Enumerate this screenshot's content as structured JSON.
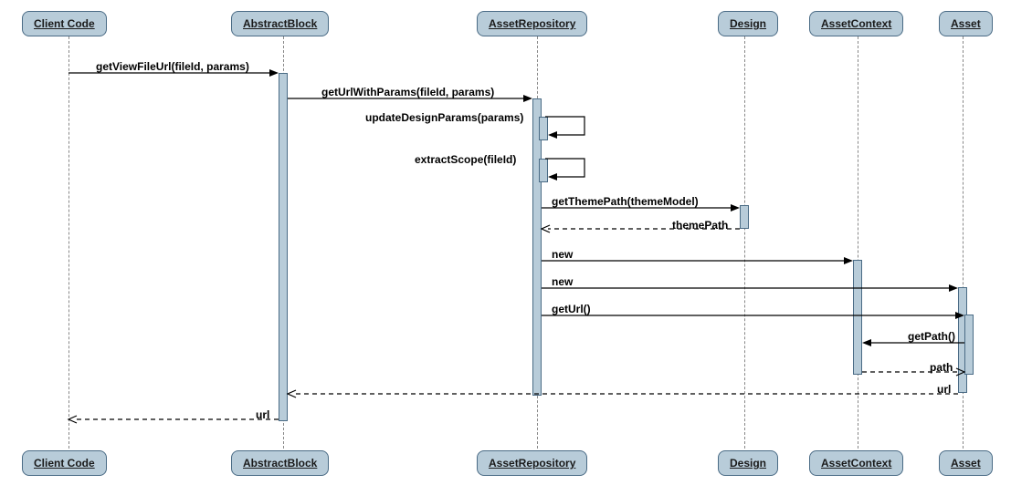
{
  "participants": {
    "client": "Client Code",
    "abstractblock": "AbstractBlock",
    "assetrepo": "AssetRepository",
    "design": "Design",
    "assetcontext": "AssetContext",
    "asset": "Asset"
  },
  "messages": {
    "m1": "getViewFileUrl(fileId, params)",
    "m2": "getUrlWithParams(fileId, params)",
    "m3": "updateDesignParams(params)",
    "m4": "extractScope(fileId)",
    "m5": "getThemePath(themeModel)",
    "m5r": "themePath",
    "m6": "new",
    "m7": "new",
    "m8": "getUrl()",
    "m9": "getPath()",
    "m9r": "path",
    "m8r": "url",
    "m1r": "url"
  }
}
